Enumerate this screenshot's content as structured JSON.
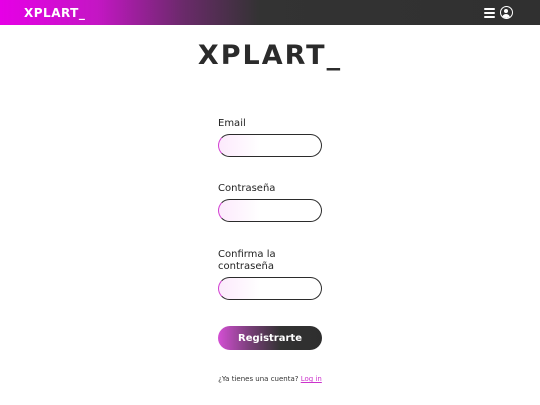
{
  "header": {
    "logo": "XPLART_",
    "menu_icon": "hamburger-menu-icon",
    "user_icon": "user-circle-icon",
    "gradient_start": "#e600e6",
    "bar_color": "#303030"
  },
  "brand": {
    "title": "XPLART_"
  },
  "form": {
    "email_label": "Email",
    "email_value": "",
    "password_label": "Contraseña",
    "password_value": "",
    "confirm_label": "Confirma la contraseña",
    "confirm_value": ""
  },
  "actions": {
    "submit_label": "Registrarte",
    "login_prompt": "¿Ya tienes una cuenta?",
    "login_link": "Log in",
    "accent": "#cc33cc"
  }
}
